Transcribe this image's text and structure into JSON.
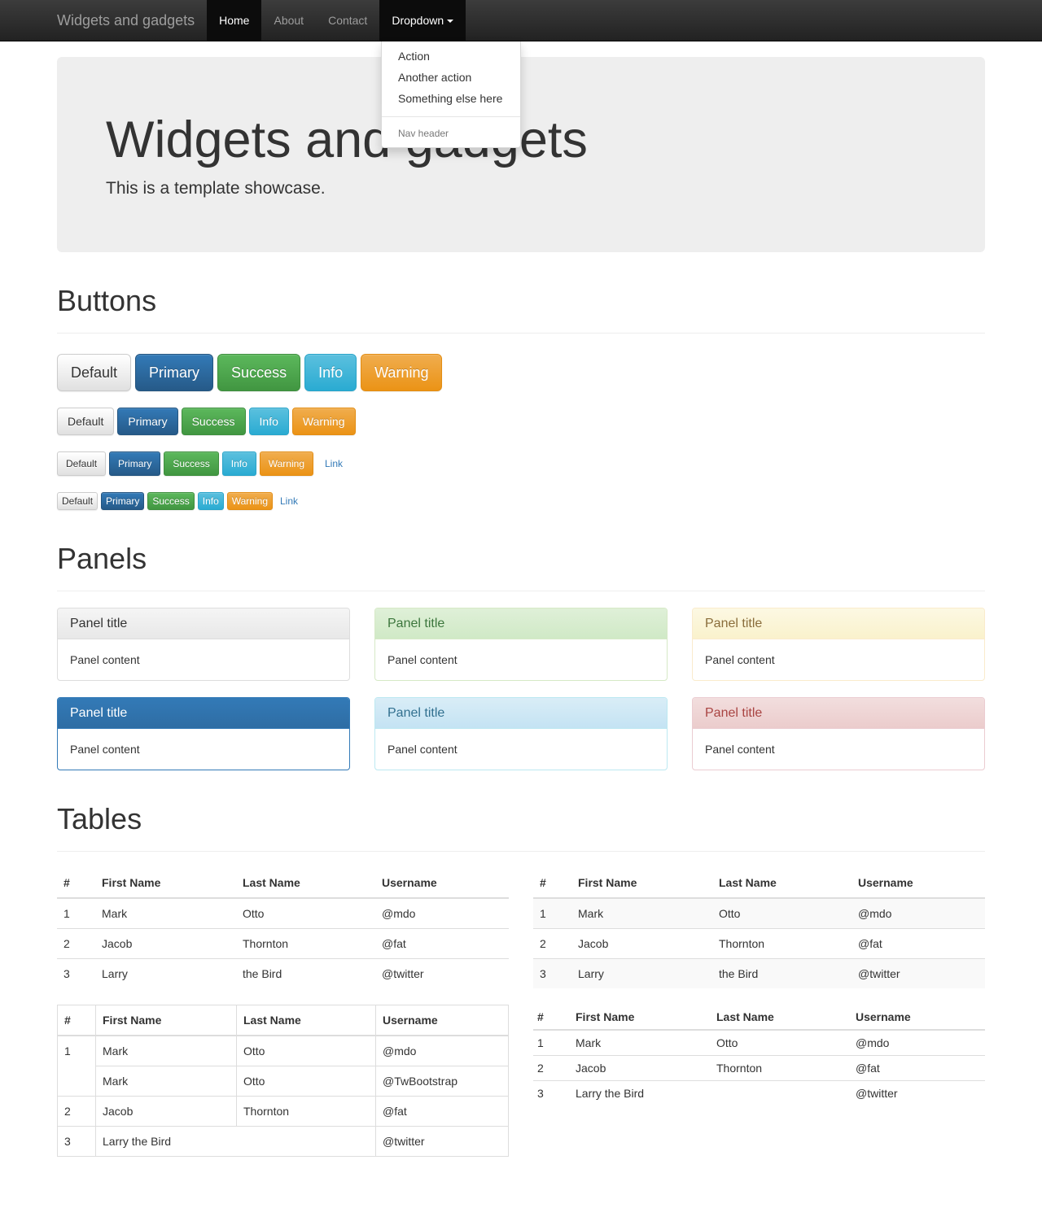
{
  "navbar": {
    "brand": "Widgets and gadgets",
    "items": [
      "Home",
      "About",
      "Contact"
    ],
    "dropdown": "Dropdown",
    "menu": [
      "Action",
      "Another action",
      "Something else here"
    ],
    "menu_header": "Nav header"
  },
  "jumbotron": {
    "title": "Widgets and gadgets",
    "subtitle": "This is a template showcase."
  },
  "buttons": {
    "heading": "Buttons",
    "labels": [
      "Default",
      "Primary",
      "Success",
      "Info",
      "Warning"
    ],
    "link": "Link"
  },
  "panels": {
    "heading": "Panels",
    "title": "Panel title",
    "content": "Panel content"
  },
  "tables": {
    "heading": "Tables",
    "headers": [
      "#",
      "First Name",
      "Last Name",
      "Username"
    ],
    "rows": [
      [
        "1",
        "Mark",
        "Otto",
        "@mdo"
      ],
      [
        "2",
        "Jacob",
        "Thornton",
        "@fat"
      ],
      [
        "3",
        "Larry",
        "the Bird",
        "@twitter"
      ]
    ],
    "bordered_rows": [
      [
        "1",
        "Mark",
        "Otto",
        "@mdo"
      ],
      [
        "",
        "Mark",
        "Otto",
        "@TwBootstrap"
      ],
      [
        "2",
        "Jacob",
        "Thornton",
        "@fat"
      ],
      [
        "3",
        "Larry the Bird",
        "",
        "@twitter"
      ]
    ]
  }
}
